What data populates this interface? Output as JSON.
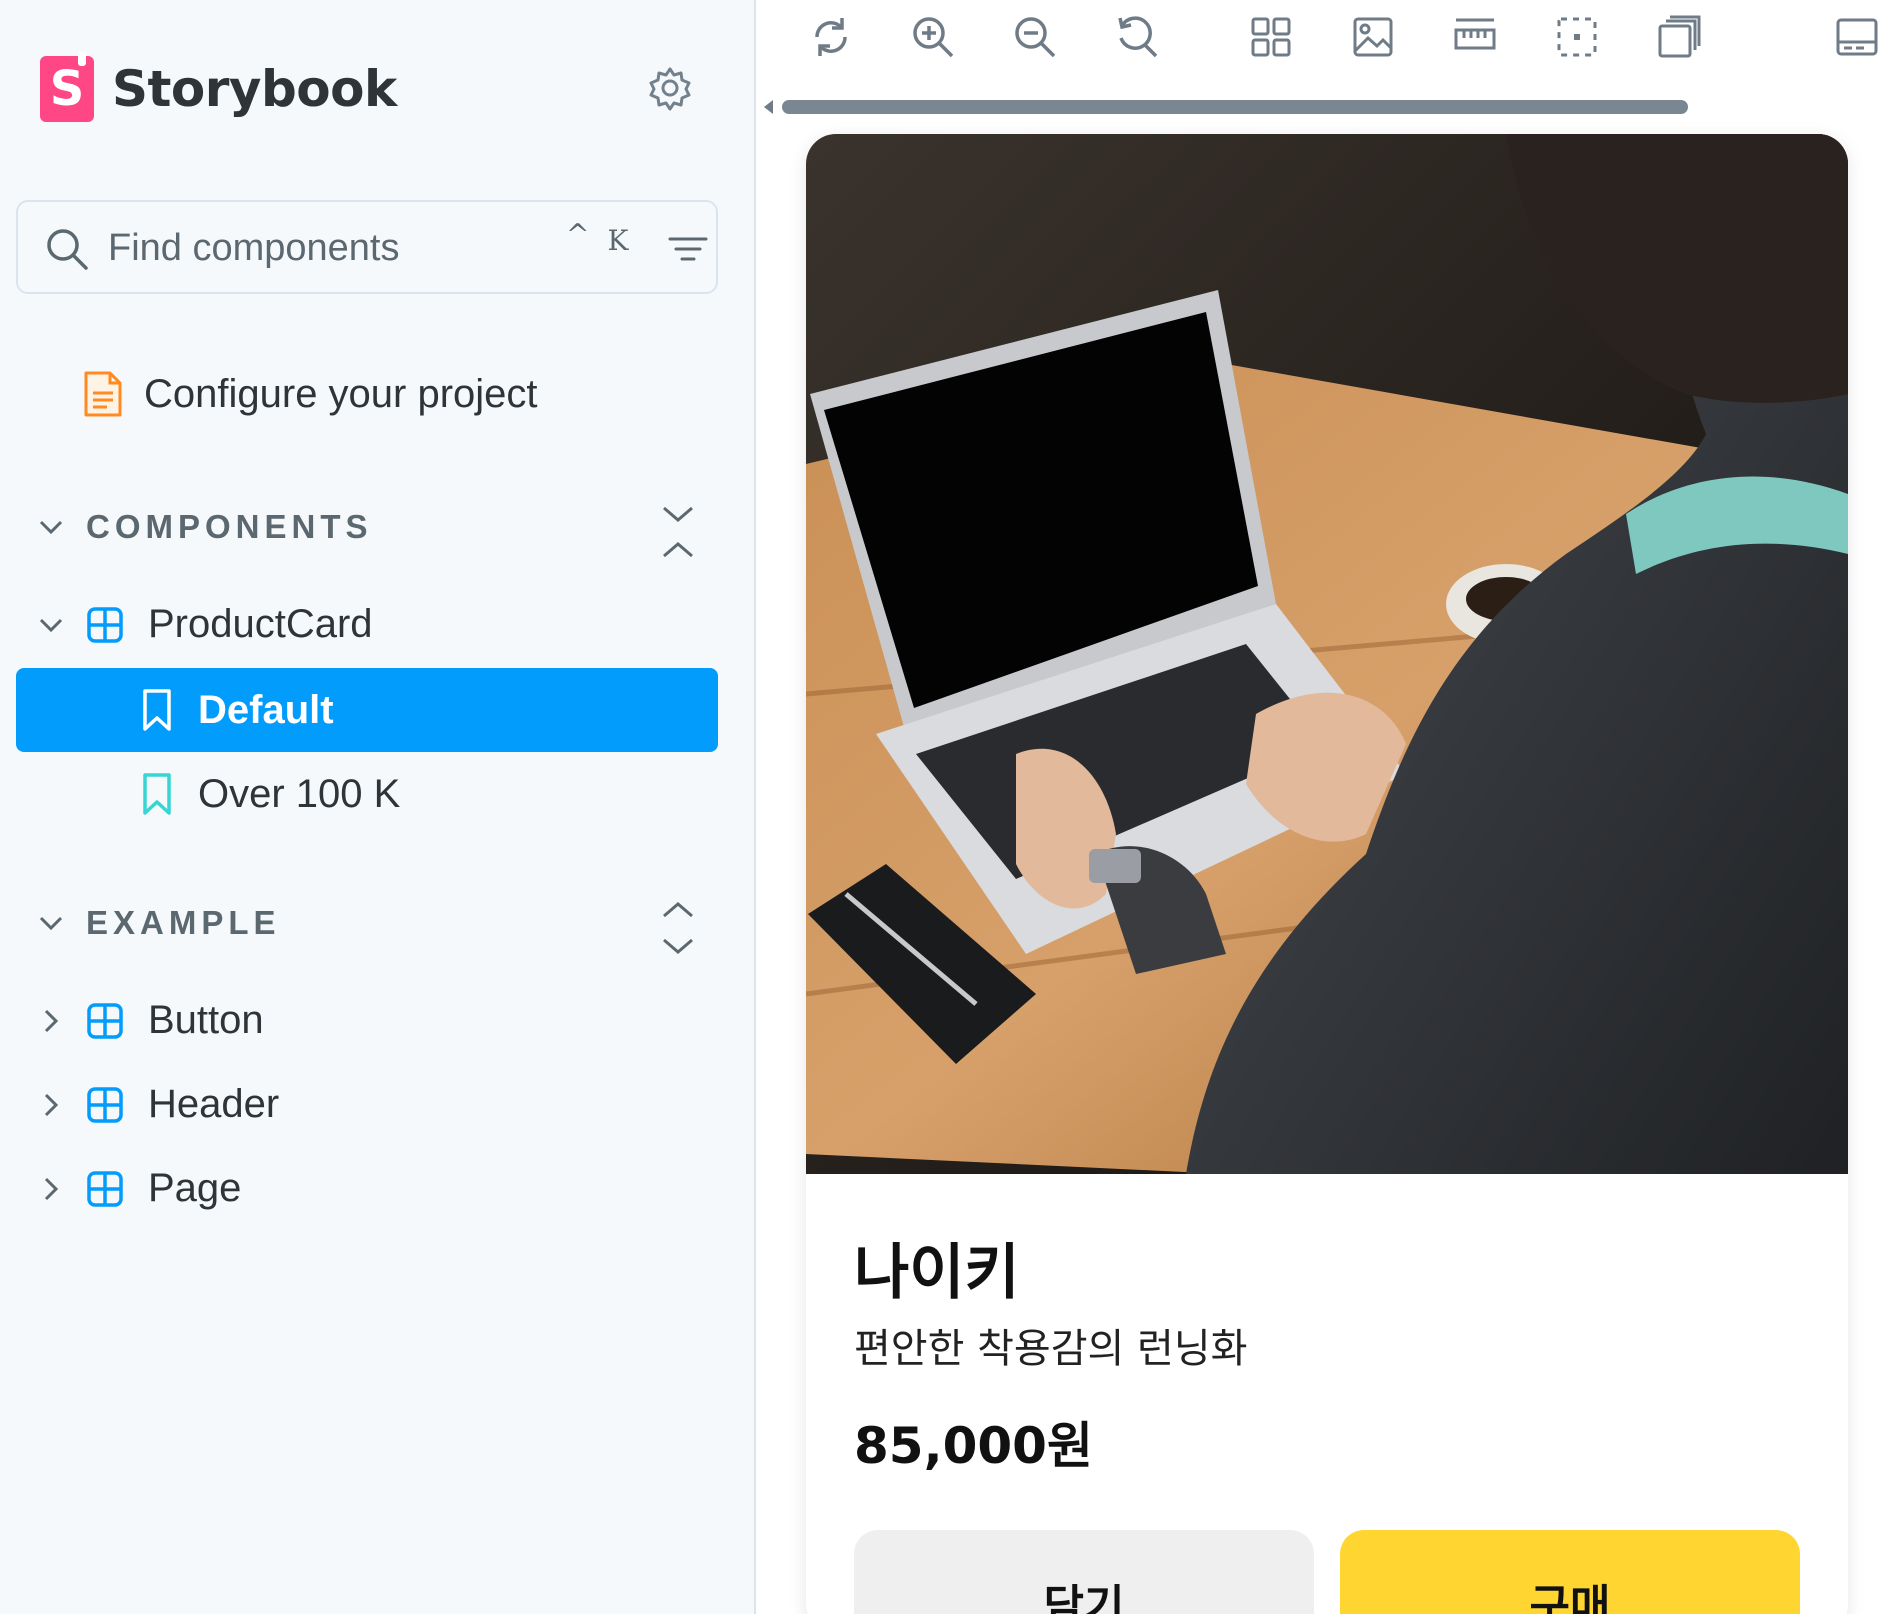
{
  "sidebar": {
    "brand": {
      "logo_letter": "S",
      "name": "Storybook",
      "logo_color": "#ff4785"
    },
    "search": {
      "placeholder": "Find components",
      "shortcut_modifier": "^",
      "shortcut_key": "K"
    },
    "configure_label": "Configure your project",
    "sections": [
      {
        "title": "COMPONENTS",
        "items": [
          {
            "label": "ProductCard",
            "expanded": true,
            "stories": [
              {
                "label": "Default",
                "selected": true
              },
              {
                "label": "Over 100 K",
                "selected": false
              }
            ]
          }
        ]
      },
      {
        "title": "EXAMPLE",
        "items": [
          {
            "label": "Button",
            "expanded": false
          },
          {
            "label": "Header",
            "expanded": false
          },
          {
            "label": "Page",
            "expanded": false
          }
        ]
      }
    ]
  },
  "toolbar": {
    "icons": [
      "reload-icon",
      "zoom-in-icon",
      "zoom-out-icon",
      "zoom-reset-icon",
      "grid-icon",
      "background-icon",
      "measure-icon",
      "outline-icon",
      "viewport-icon",
      "addons-panel-icon"
    ]
  },
  "card": {
    "name": "나이키",
    "description": "편안한 착용감의 런닝화",
    "price": "85,000원",
    "cart_label": "담기",
    "buy_label": "구매"
  },
  "colors": {
    "accent": "#029cfd",
    "sidebar_bg": "#f6f9fc",
    "buy_button": "#ffd631",
    "cart_button": "#efefef",
    "component_icon": "#029cfd",
    "story_icon": "#37d5d3",
    "doc_icon": "#ff8a1f"
  }
}
